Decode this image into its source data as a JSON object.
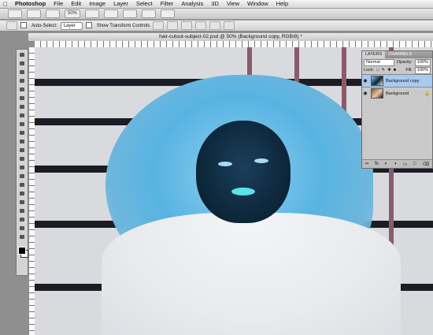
{
  "menubar": {
    "apple": "",
    "app": "Photoshop",
    "items": [
      "File",
      "Edit",
      "Image",
      "Layer",
      "Select",
      "Filter",
      "Analysis",
      "3D",
      "View",
      "Window",
      "Help"
    ]
  },
  "appbar": {
    "zoom": "50%"
  },
  "options": {
    "auto_select_label": "Auto-Select:",
    "auto_select_value": "Layer",
    "transform_label": "Show Transform Controls"
  },
  "document": {
    "title": "hair-cutout-subject-02.psd @ 50% (Background copy, RGB/8) *"
  },
  "layers_panel": {
    "tabs": [
      "LAYERS",
      "CHANNELS"
    ],
    "blend_mode": "Normal",
    "opacity_label": "Opacity:",
    "opacity_value": "100%",
    "lock_label": "Lock:",
    "fill_label": "Fill:",
    "fill_value": "100%",
    "layers": [
      {
        "name": "Background copy",
        "active": true
      },
      {
        "name": "Background",
        "active": false
      }
    ],
    "footer_icons": [
      "link-icon",
      "fx-icon",
      "mask-icon",
      "adjustment-icon",
      "folder-icon",
      "new-layer-icon",
      "trash-icon"
    ]
  },
  "colors": {
    "accent_selection": "#aac9ee",
    "hair": "#58b3e2",
    "face": "#0c2538",
    "lips": "#5ce3e7"
  }
}
